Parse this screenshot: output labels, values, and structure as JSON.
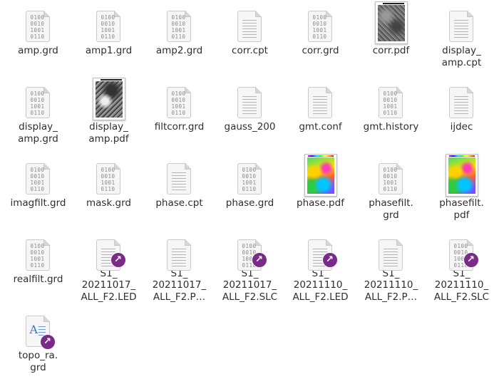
{
  "files": [
    {
      "name": "amp.grd",
      "kind": "binary"
    },
    {
      "name": "amp1.grd",
      "kind": "binary"
    },
    {
      "name": "amp2.grd",
      "kind": "binary"
    },
    {
      "name": "corr.cpt",
      "kind": "text"
    },
    {
      "name": "corr.grd",
      "kind": "binary"
    },
    {
      "name": "corr.pdf",
      "kind": "thumb-gray"
    },
    {
      "name": "display_\namp.cpt",
      "kind": "text"
    },
    {
      "name": "display_\namp.grd",
      "kind": "binary"
    },
    {
      "name": "display_\namp.pdf",
      "kind": "thumb-gray"
    },
    {
      "name": "filtcorr.grd",
      "kind": "binary"
    },
    {
      "name": "gauss_200",
      "kind": "text"
    },
    {
      "name": "gmt.conf",
      "kind": "text"
    },
    {
      "name": "gmt.history",
      "kind": "binary"
    },
    {
      "name": "ijdec",
      "kind": "text"
    },
    {
      "name": "imagfilt.grd",
      "kind": "binary"
    },
    {
      "name": "mask.grd",
      "kind": "binary"
    },
    {
      "name": "phase.cpt",
      "kind": "text"
    },
    {
      "name": "phase.grd",
      "kind": "binary"
    },
    {
      "name": "phase.pdf",
      "kind": "thumb-color"
    },
    {
      "name": "phasefilt.\ngrd",
      "kind": "binary"
    },
    {
      "name": "phasefilt.\npdf",
      "kind": "thumb-color"
    },
    {
      "name": "realfilt.grd",
      "kind": "binary"
    },
    {
      "name": "S1_\n20211017_\nALL_F2.LED",
      "kind": "text",
      "link": true
    },
    {
      "name": "S1_\n20211017_\nALL_F2.P…",
      "kind": "text"
    },
    {
      "name": "S1_\n20211017_\nALL_F2.SLC",
      "kind": "binary",
      "link": true
    },
    {
      "name": "S1_\n20211110_\nALL_F2.LED",
      "kind": "text",
      "link": true
    },
    {
      "name": "S1_\n20211110_\nALL_F2.P…",
      "kind": "text"
    },
    {
      "name": "S1_\n20211110_\nALL_F2.SLC",
      "kind": "binary",
      "link": true
    },
    {
      "name": "topo_ra.\ngrd",
      "kind": "rich",
      "link": true
    }
  ],
  "binary_glyph_lines": [
    "0100",
    "0010",
    "1001",
    "0110"
  ],
  "link_badge_glyph": "↗",
  "rich_glyph": "A",
  "colors": {
    "link_badge": "#7a2b87",
    "rich_icon": "#3b74c3"
  }
}
